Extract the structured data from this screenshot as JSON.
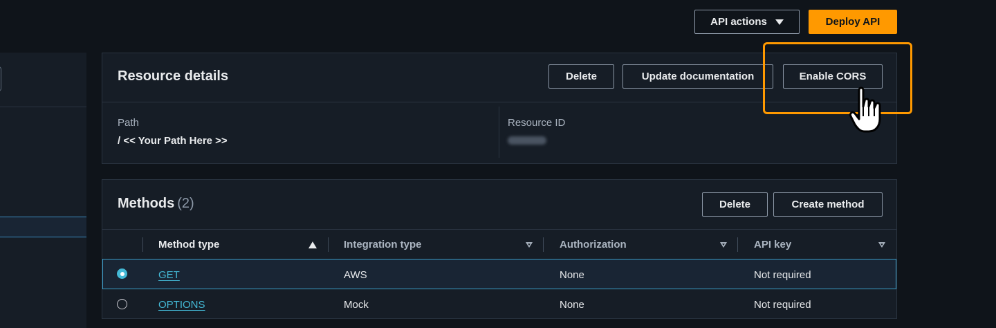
{
  "topbar": {
    "api_actions_label": "API actions",
    "deploy_api_label": "Deploy API"
  },
  "resource_details": {
    "title": "Resource details",
    "delete_label": "Delete",
    "update_docs_label": "Update documentation",
    "enable_cors_label": "Enable CORS",
    "path_label": "Path",
    "path_value": "/ << Your Path Here >>",
    "resource_id_label": "Resource ID"
  },
  "methods": {
    "title": "Methods",
    "count": "(2)",
    "delete_label": "Delete",
    "create_label": "Create method",
    "columns": [
      "Method type",
      "Integration type",
      "Authorization",
      "API key"
    ],
    "rows": [
      {
        "method": "GET",
        "integration": "AWS",
        "authorization": "None",
        "api_key": "Not required"
      },
      {
        "method": "OPTIONS",
        "integration": "Mock",
        "authorization": "None",
        "api_key": "Not required"
      }
    ]
  },
  "colors": {
    "accent": "#ff9900",
    "link": "#44b9d6",
    "background": "#0f141a",
    "panel": "#161d26"
  },
  "icons": {
    "api_actions_caret": "caret-down-icon",
    "sort_ascending": "sort-ascending-icon",
    "sort_none": "sort-descending-icon",
    "pointer": "hand-pointer-icon"
  }
}
